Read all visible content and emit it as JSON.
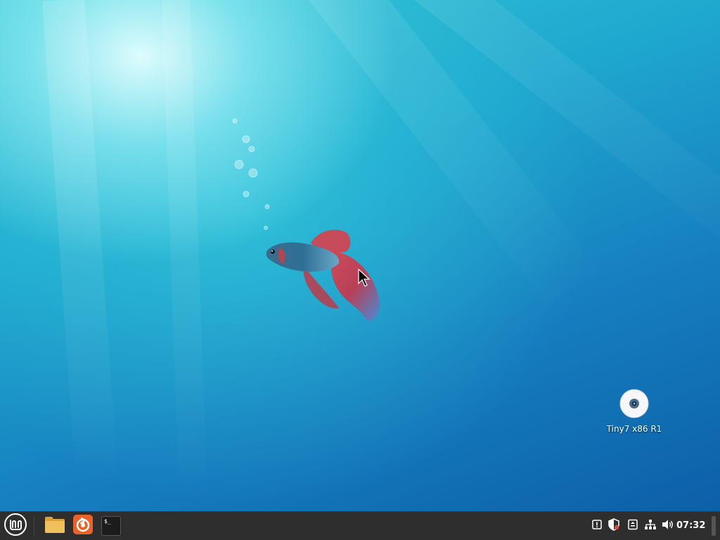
{
  "desktop": {
    "icons": [
      {
        "label": "Tiny7 x86 R1",
        "icon": "optical-disc-icon"
      }
    ]
  },
  "taskbar": {
    "menu_icon": "linux-mint-menu-icon",
    "launchers": [
      {
        "icon": "file-manager-icon"
      },
      {
        "icon": "firefox-icon"
      },
      {
        "icon": "terminal-icon",
        "text": "$_"
      }
    ],
    "tray": [
      {
        "icon": "notifications-icon"
      },
      {
        "icon": "update-shield-icon"
      },
      {
        "icon": "removable-drive-icon"
      },
      {
        "icon": "network-icon"
      },
      {
        "icon": "volume-icon"
      }
    ],
    "clock": "07:32"
  },
  "colors": {
    "taskbar_bg": "#2e2e2e",
    "firefox_orange": "#e8622a",
    "folder_yellow": "#f0c15a"
  }
}
